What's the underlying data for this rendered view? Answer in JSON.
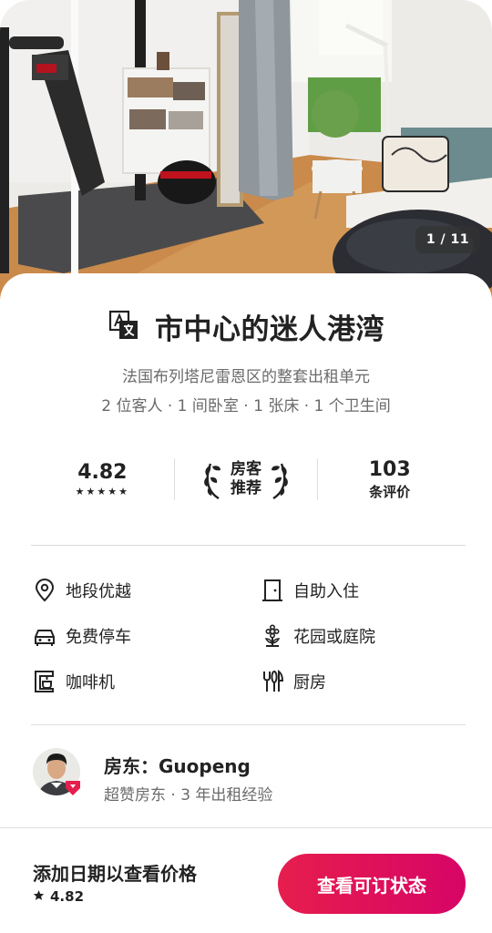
{
  "listing": {
    "photo_counter": "1 / 11",
    "title": "市中心的迷人港湾",
    "subtitle_line1": "法国布列塔尼雷恩区的整套出租单元",
    "subtitle_line2": "2 位客人 · 1 间卧室 · 1 张床 · 1 个卫生间"
  },
  "stats": {
    "rating": "4.82",
    "stars": "★★★★★",
    "guest_favorite_line1": "房客",
    "guest_favorite_line2": "推荐",
    "reviews_count": "103",
    "reviews_label": "条评价"
  },
  "amenities": [
    {
      "label": "地段优越",
      "icon": "location-pin-icon"
    },
    {
      "label": "自助入住",
      "icon": "door-icon"
    },
    {
      "label": "免费停车",
      "icon": "car-icon"
    },
    {
      "label": "花园或庭院",
      "icon": "flower-icon"
    },
    {
      "label": "咖啡机",
      "icon": "coffee-machine-icon"
    },
    {
      "label": "厨房",
      "icon": "utensils-icon"
    }
  ],
  "host": {
    "name": "房东：Guopeng",
    "details": "超赞房东 · 3 年出租经验"
  },
  "footer": {
    "prompt": "添加日期以查看价格",
    "rating": "4.82",
    "cta_label": "查看可订状态"
  },
  "colors": {
    "accent": "#e61e4d",
    "accent_end": "#d70466",
    "text": "#222222",
    "muted": "#6a6a6a"
  }
}
